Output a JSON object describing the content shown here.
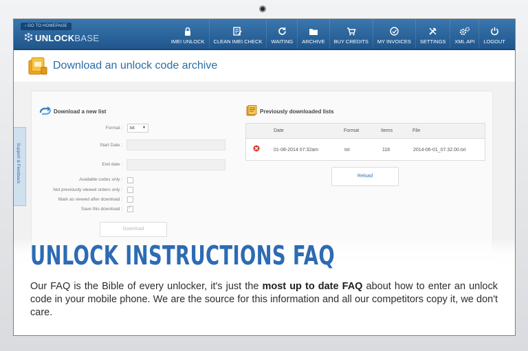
{
  "header": {
    "home_link": "Go to homepage",
    "logo_bold": "UNLOCK",
    "logo_thin": "BASE"
  },
  "nav": [
    {
      "label": "IMEI Unlock",
      "icon": "lock-icon"
    },
    {
      "label": "Clean IMEI Check",
      "icon": "checklist-icon"
    },
    {
      "label": "Waiting",
      "icon": "refresh-icon"
    },
    {
      "label": "Archive",
      "icon": "folder-icon"
    },
    {
      "label": "Buy Credits",
      "icon": "cart-icon"
    },
    {
      "label": "My Invoices",
      "icon": "invoice-icon"
    },
    {
      "label": "Settings",
      "icon": "wrench-icon"
    },
    {
      "label": "XML API",
      "icon": "gears-icon"
    },
    {
      "label": "Logout",
      "icon": "power-icon"
    }
  ],
  "page": {
    "title": "Download an unlock code archive"
  },
  "download_form": {
    "section_title": "Download a new list",
    "format_label": "Format :",
    "format_value": "txt",
    "start_date_label": "Start Date :",
    "start_date_value": "",
    "end_date_label": "End date :",
    "end_date_value": "",
    "available_only_label": "Available codes only :",
    "available_only_checked": false,
    "not_viewed_label": "Not previously viewed orders only :",
    "not_viewed_checked": false,
    "mark_viewed_label": "Mark as viewed after download :",
    "mark_viewed_checked": false,
    "save_download_label": "Save this download :",
    "save_download_checked": true,
    "download_button": "Download"
  },
  "previous": {
    "section_title": "Previously downloaded lists",
    "columns": [
      "Date",
      "Format",
      "Items",
      "File"
    ],
    "rows": [
      {
        "date": "01-08-2014 07:32am",
        "format": "txt",
        "items": "116",
        "file": "2014-06-01_07.32.00.txt"
      }
    ],
    "reload_button": "Reload"
  },
  "support_tab": "Support & Feedback",
  "faq": {
    "title": "UNLOCK INSTRUCTIONS FAQ",
    "body_before": "Our FAQ is the Bible of every unlocker, it's just the ",
    "body_bold": "most up to date FAQ",
    "body_after": " about how to enter an unlock code in your mobile phone. We are the source for this information and all our competitors copy it, we don't care."
  },
  "colors": {
    "nav_blue": "#20568c",
    "title_blue": "#2b6ca3",
    "faq_blue": "#2d6bb3",
    "delete_red": "#d9342b"
  }
}
